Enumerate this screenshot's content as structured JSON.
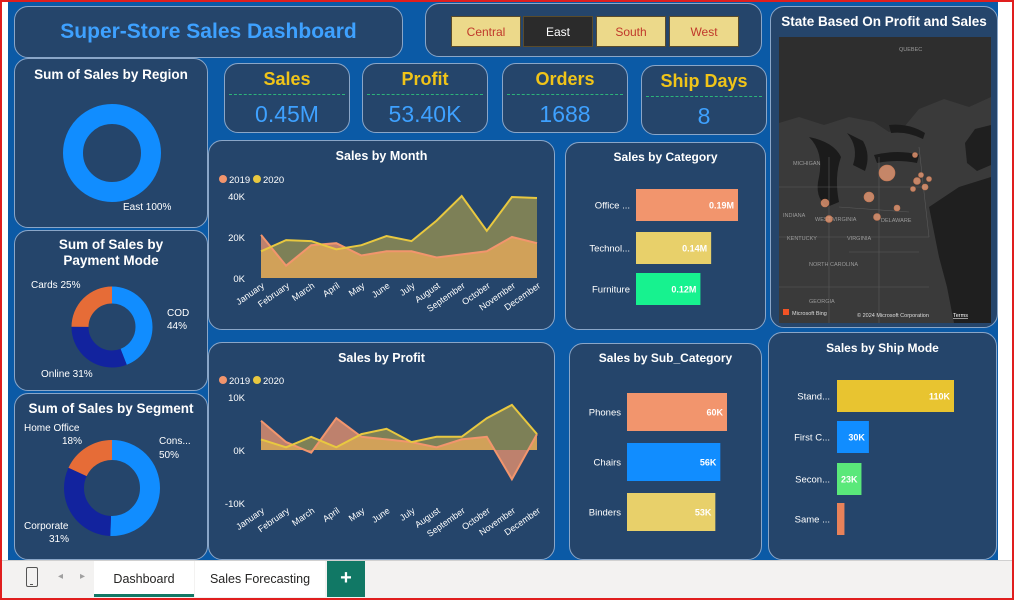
{
  "title": "Super-Store Sales Dashboard",
  "slicer": {
    "options": [
      "Central",
      "East",
      "South",
      "West"
    ],
    "selected": "East"
  },
  "kpis": [
    {
      "label": "Sales",
      "value": "0.45M"
    },
    {
      "label": "Profit",
      "value": "53.40K"
    },
    {
      "label": "Orders",
      "value": "1688"
    },
    {
      "label": "Ship Days",
      "value": "8"
    }
  ],
  "map": {
    "title": "State Based On Profit and Sales",
    "labels": [
      "QUEBEC",
      "MICHIGAN",
      "INDIANA",
      "WEST VIRGINIA",
      "DELAWARE",
      "KENTUCKY",
      "VIRGINIA",
      "NORTH CAROLINA",
      "GEORGIA"
    ],
    "attribution": "Microsoft Bing",
    "copyright": "© 2024 Microsoft Corporation",
    "terms": "Terms"
  },
  "region_chart": {
    "title": "Sum of Sales by Region",
    "label": "East 100%",
    "colors": [
      "#118dff"
    ]
  },
  "payment_chart": {
    "title": "Sum of Sales by Payment Mode",
    "labels": {
      "cards": "Cards 25%",
      "cod_name": "COD",
      "cod_pct": "44%",
      "online": "Online 31%"
    }
  },
  "segment_chart": {
    "title": "Sum of Sales by Segment",
    "labels": {
      "home_name": "Home Office",
      "home_pct": "18%",
      "cons_name": "Cons...",
      "cons_pct": "50%",
      "corp_name": "Corporate",
      "corp_pct": "31%"
    }
  },
  "month_chart": {
    "title": "Sales by Month",
    "legend": [
      "2019",
      "2020"
    ],
    "yticks": [
      "40K",
      "20K",
      "0K"
    ]
  },
  "profit_chart": {
    "title": "Sales by Profit",
    "legend": [
      "2019",
      "2020"
    ],
    "yticks": [
      "10K",
      "0K",
      "-10K"
    ]
  },
  "category_chart": {
    "title": "Sales by Category"
  },
  "subcat_chart": {
    "title": "Sales by Sub_Category"
  },
  "shipmode_chart": {
    "title": "Sales by Ship Mode"
  },
  "tabs": {
    "dashboard": "Dashboard",
    "forecast": "Sales Forecasting",
    "add": "+"
  },
  "colors": {
    "y2019": "#f2956d",
    "y2020": "#e8c840",
    "blue": "#118dff",
    "navy": "#12239e",
    "orange": "#e66c37",
    "green": "#1aab40"
  },
  "chart_data": [
    {
      "type": "pie",
      "title": "Sum of Sales by Region",
      "categories": [
        "East"
      ],
      "values": [
        100
      ]
    },
    {
      "type": "pie",
      "title": "Sum of Sales by Payment Mode",
      "categories": [
        "COD",
        "Online",
        "Cards"
      ],
      "values": [
        44,
        31,
        25
      ]
    },
    {
      "type": "pie",
      "title": "Sum of Sales by Segment",
      "categories": [
        "Cons...",
        "Corporate",
        "Home Office"
      ],
      "values": [
        50,
        31,
        18
      ]
    },
    {
      "type": "area",
      "title": "Sales by Month",
      "categories": [
        "January",
        "February",
        "March",
        "April",
        "May",
        "June",
        "July",
        "August",
        "September",
        "October",
        "November",
        "December"
      ],
      "series": [
        {
          "name": "2019",
          "values": [
            21000,
            6000,
            16000,
            17000,
            11000,
            13000,
            13000,
            10000,
            11500,
            13000,
            20000,
            17000
          ]
        },
        {
          "name": "2020",
          "values": [
            13000,
            18500,
            18000,
            14000,
            16000,
            20500,
            18000,
            28000,
            40000,
            23000,
            39500,
            39000
          ]
        }
      ],
      "ylim": [
        0,
        40000
      ]
    },
    {
      "type": "area",
      "title": "Sales by Profit",
      "categories": [
        "January",
        "February",
        "March",
        "April",
        "May",
        "June",
        "July",
        "August",
        "September",
        "October",
        "November",
        "December"
      ],
      "series": [
        {
          "name": "2019",
          "values": [
            5500,
            1500,
            -500,
            6000,
            2500,
            2000,
            1500,
            500,
            2000,
            2500,
            -5500,
            3000
          ]
        },
        {
          "name": "2020",
          "values": [
            2000,
            500,
            2500,
            500,
            3000,
            4000,
            1500,
            2500,
            2500,
            6000,
            8500,
            3000
          ]
        }
      ],
      "ylim": [
        -10000,
        10000
      ]
    },
    {
      "type": "bar",
      "title": "Sales by Category",
      "categories": [
        "Office ...",
        "Technol...",
        "Furniture"
      ],
      "values": [
        0.19,
        0.14,
        0.12
      ],
      "labels": [
        "0.19M",
        "0.14M",
        "0.12M"
      ],
      "colors": [
        "#f2956d",
        "#e8d06a",
        "#17f28f"
      ],
      "xlim": [
        0,
        0.19
      ]
    },
    {
      "type": "bar",
      "title": "Sales by Sub_Category",
      "categories": [
        "Phones",
        "Chairs",
        "Binders"
      ],
      "values": [
        60,
        56,
        53
      ],
      "labels": [
        "60K",
        "56K",
        "53K"
      ],
      "colors": [
        "#f2956d",
        "#118dff",
        "#e8d06a"
      ],
      "xlim": [
        0,
        60
      ]
    },
    {
      "type": "bar",
      "title": "Sales by Ship Mode",
      "categories": [
        "Stand...",
        "First C...",
        "Secon...",
        "Same ..."
      ],
      "values": [
        110,
        30,
        23,
        7
      ],
      "labels": [
        "110K",
        "30K",
        "23K",
        ""
      ],
      "colors": [
        "#e8c430",
        "#118dff",
        "#5ae87a",
        "#e8825a"
      ],
      "xlim": [
        0,
        110
      ]
    }
  ]
}
